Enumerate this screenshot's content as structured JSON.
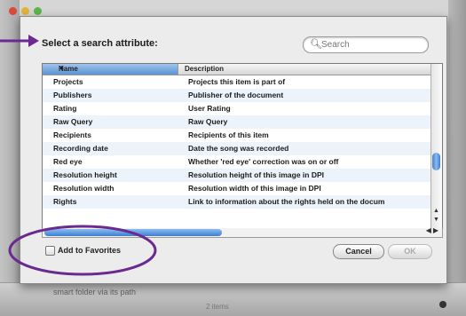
{
  "dialog": {
    "prompt": "Select a search attribute:",
    "search_placeholder": "Search"
  },
  "table": {
    "columns": [
      "Name",
      "Description"
    ],
    "rows": [
      {
        "name": "Projects",
        "description": "Projects this item is part of"
      },
      {
        "name": "Publishers",
        "description": "Publisher of the document"
      },
      {
        "name": "Rating",
        "description": "User Rating"
      },
      {
        "name": "Raw Query",
        "description": "Raw Query"
      },
      {
        "name": "Recipients",
        "description": "Recipients of this item"
      },
      {
        "name": "Recording date",
        "description": "Date the song was recorded"
      },
      {
        "name": "Red eye",
        "description": "Whether 'red eye' correction was on or off"
      },
      {
        "name": "Resolution height",
        "description": "Resolution height of this image in DPI"
      },
      {
        "name": "Resolution width",
        "description": "Resolution width of this image in DPI"
      },
      {
        "name": "Rights",
        "description": "Link to information about the rights held on the docum"
      }
    ]
  },
  "favorites": {
    "label": "Add to Favorites"
  },
  "buttons": {
    "cancel": "Cancel",
    "ok": "OK"
  },
  "background": {
    "bottom_text": "smart folder via its path",
    "bottom_center": "2 items"
  },
  "colors": {
    "annotation": "#6a2a8f",
    "selection": "#5d92d2"
  }
}
